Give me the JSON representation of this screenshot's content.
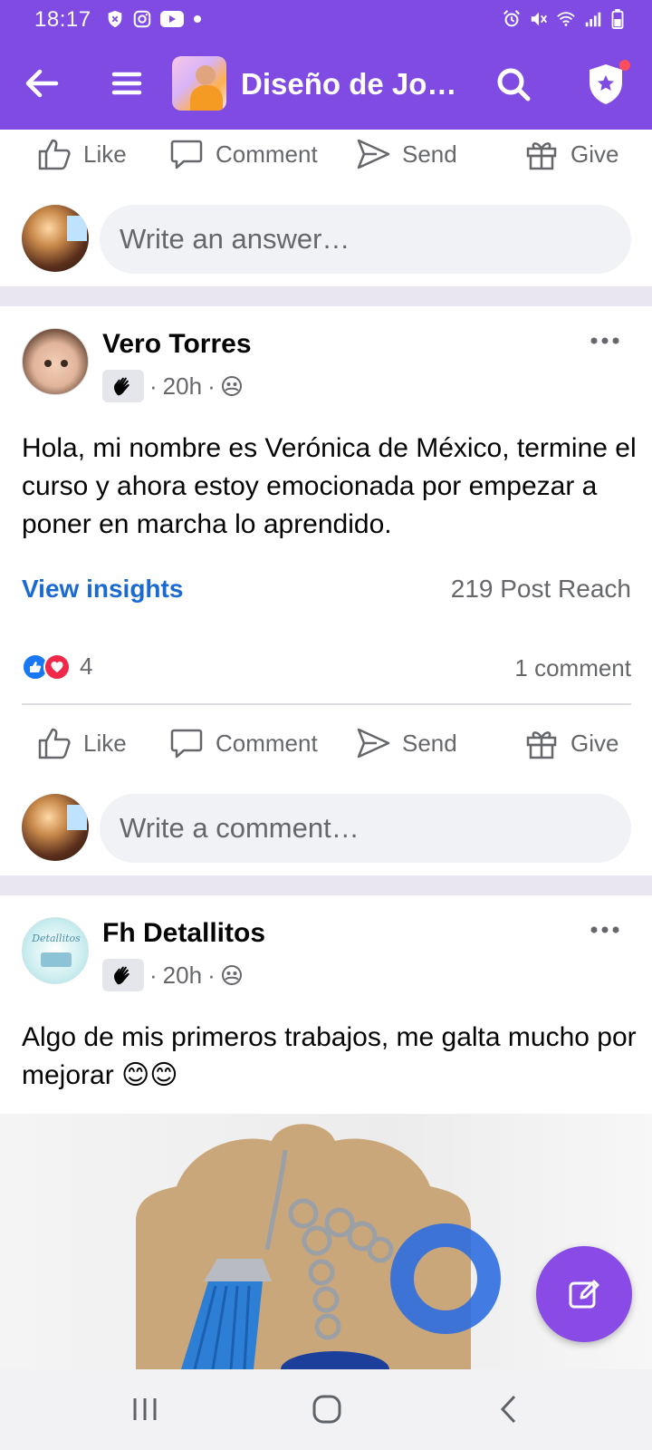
{
  "status": {
    "time": "18:17",
    "left_icons": [
      "shield-notification-icon",
      "instagram-icon",
      "youtube-icon",
      "dot-icon"
    ],
    "right_icons": [
      "alarm-icon",
      "mute-icon",
      "wifi-icon",
      "signal-icon",
      "battery-icon"
    ]
  },
  "header": {
    "title": "Diseño de Joy…",
    "back_icon": "arrow-left-icon",
    "menu_icon": "hamburger-icon",
    "search_icon": "search-icon",
    "admin_icon": "shield-star-icon",
    "accent_color": "#7f4be3"
  },
  "actions": {
    "like": "Like",
    "comment": "Comment",
    "send": "Send",
    "give": "Give"
  },
  "prev_post": {
    "answer_placeholder": "Write an answer…"
  },
  "posts": [
    {
      "author": "Vero Torres",
      "time": "20h",
      "separator": "·",
      "text": "Hola, mi nombre es Verónica de México, termine el curso y ahora estoy emocionada por empezar a poner en marcha lo aprendido.",
      "insights_label": "View insights",
      "reach": "219 Post Reach",
      "reaction_count": "4",
      "comments": "1 comment",
      "comment_placeholder": "Write a comment…"
    },
    {
      "author": "Fh Detallitos",
      "time": "20h",
      "separator": "·",
      "text": "Algo de mis primeros trabajos, me galta mucho por mejorar 😊😊"
    }
  ],
  "fab_icon": "edit-icon",
  "nav": [
    "recents-icon",
    "home-icon",
    "back-icon"
  ]
}
